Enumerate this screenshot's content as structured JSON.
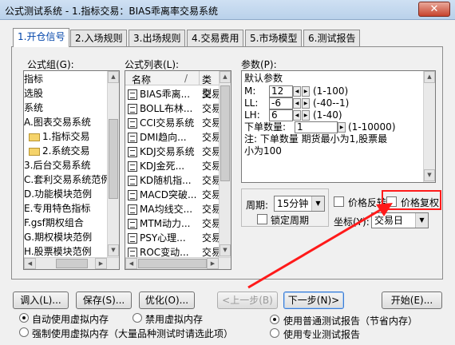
{
  "window": {
    "title": "公式测试系统 - 1.指标交易：BIAS乖离率交易系统",
    "close_label": "✕"
  },
  "tabs": [
    {
      "label": "1.开仓信号"
    },
    {
      "label": "2.入场规则"
    },
    {
      "label": "3.出场规则"
    },
    {
      "label": "4.交易费用"
    },
    {
      "label": "5.市场模型"
    },
    {
      "label": "6.测试报告"
    }
  ],
  "formula_group": {
    "label": "公式组(G):",
    "items": [
      "指标",
      "选股",
      "系统",
      "A.图表交易系统",
      "1.指标交易",
      "2.系统交易",
      "3.后台交易系统",
      "C.套利交易系统范例",
      "D.功能模块范例",
      "E.专用特色指标",
      "F.gsf期权组合",
      "G.期权模块范例",
      "H.股票模块范例"
    ]
  },
  "formula_list": {
    "label": "公式列表(L):",
    "col_name": "名称",
    "col_sep": "/",
    "col_type": "类型",
    "rows": [
      {
        "name": "BIAS乖离...",
        "type": "交易"
      },
      {
        "name": "BOLL布林...",
        "type": "交易"
      },
      {
        "name": "CCI交易系统",
        "type": "交易"
      },
      {
        "name": "DMI趋向...",
        "type": "交易"
      },
      {
        "name": "KDJ交易系统",
        "type": "交易"
      },
      {
        "name": "KDJ金死...",
        "type": "交易"
      },
      {
        "name": "KD随机指...",
        "type": "交易"
      },
      {
        "name": "MACD突破...",
        "type": "交易"
      },
      {
        "name": "MA均线交...",
        "type": "交易"
      },
      {
        "name": "MTM动力...",
        "type": "交易"
      },
      {
        "name": "PSY心理...",
        "type": "交易"
      },
      {
        "name": "ROC变动...",
        "type": "交易"
      }
    ]
  },
  "params": {
    "label": "参数(P):",
    "heading": "默认参数",
    "rows": [
      {
        "name": "M:",
        "value": "12",
        "range": "(1-100)"
      },
      {
        "name": "LL:",
        "value": "-6",
        "range": "(-40--1)"
      },
      {
        "name": "LH:",
        "value": "6",
        "range": "(1-40)"
      }
    ],
    "min_qty_label": "下单数量:",
    "min_qty_value": "1",
    "min_qty_range": "(1-10000)",
    "note_line1": "注: 下单数量 期货最小为1,股票最",
    "note_line2": "小为100"
  },
  "period": {
    "label": "周期:",
    "value": "15分钟"
  },
  "lock_period": "锁定周期",
  "price_invert": "价格反转",
  "price_adjust": "价格复权",
  "coord": {
    "label": "坐标(Y):",
    "value": "交易日"
  },
  "buttons": {
    "import": "调入(L)...",
    "save": "保存(S)...",
    "optimize": "优化(O)...",
    "prev": "<上一步(B)",
    "next": "下一步(N)>",
    "start": "开始(E)..."
  },
  "memory_options": {
    "auto": "自动使用虚拟内存",
    "disable": "禁用虚拟内存",
    "force": "强制使用虚拟内存（大量品种测试时请选此项）"
  },
  "report_options": {
    "normal": "使用普通测试报告（节省内存）",
    "pro": "使用专业测试报告"
  },
  "colors": {
    "annotation": "#ff1a1a",
    "accent": "#0044aa"
  }
}
